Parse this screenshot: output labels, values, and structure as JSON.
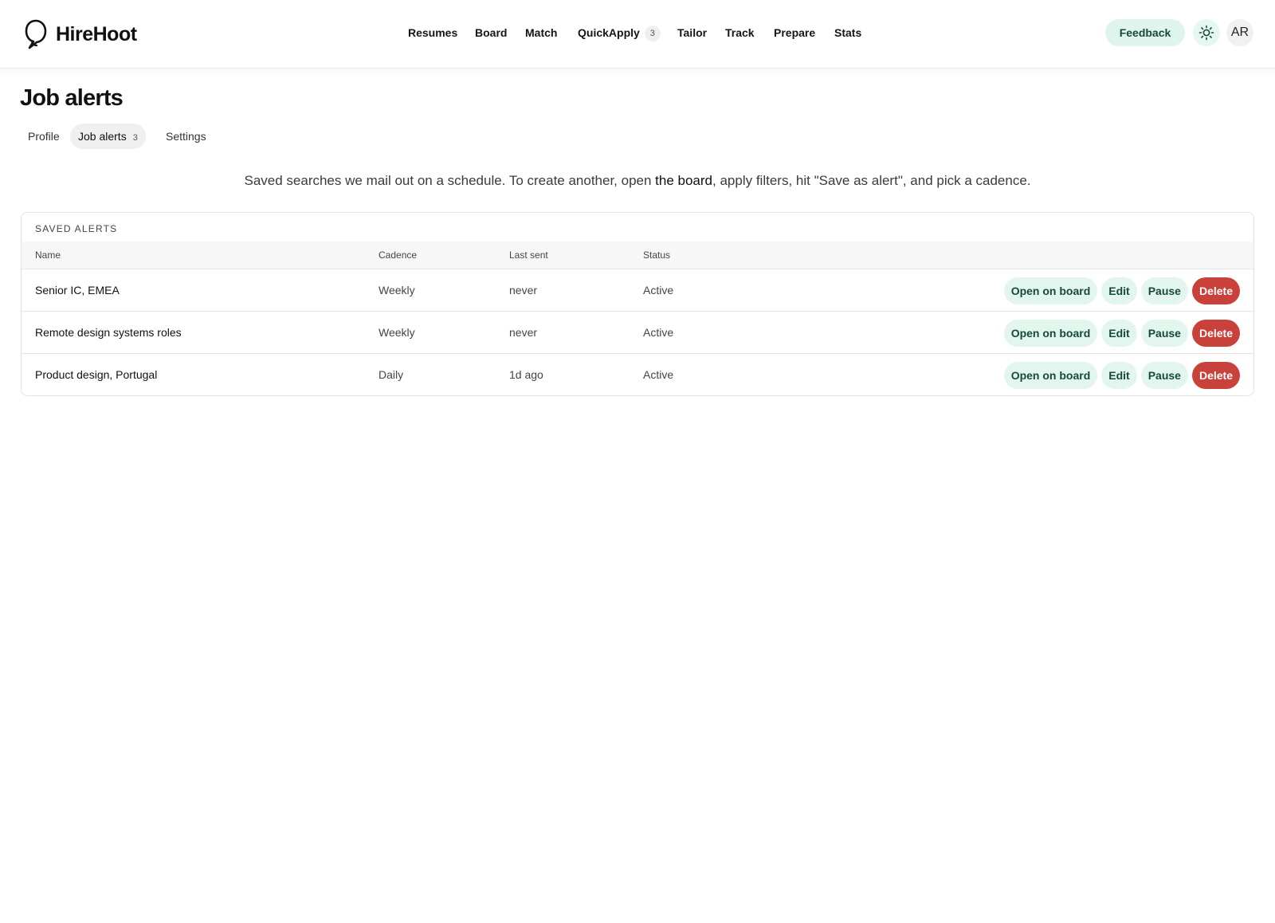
{
  "app": {
    "name": "HireHoot"
  },
  "nav": {
    "items": [
      {
        "label": "Resumes"
      },
      {
        "label": "Board"
      },
      {
        "label": "Match"
      },
      {
        "label": "QuickApply",
        "badge": "3"
      },
      {
        "label": "Tailor"
      },
      {
        "label": "Track"
      },
      {
        "label": "Prepare"
      },
      {
        "label": "Stats"
      }
    ]
  },
  "header": {
    "feedback_label": "Feedback",
    "theme_icon": "sun-icon",
    "avatar_initials": "AR"
  },
  "page": {
    "title": "Job alerts",
    "tabs": [
      {
        "label": "Profile"
      },
      {
        "label": "Job alerts",
        "count": "3"
      },
      {
        "label": "Settings"
      }
    ],
    "active_tab": "Job alerts",
    "intro_before": "Saved searches we mail out on a schedule. To create another, open ",
    "intro_link": "the board",
    "intro_after": ", apply filters, hit \"Save as alert\", and pick a cadence."
  },
  "alerts": {
    "section_label": "SAVED ALERTS",
    "columns": [
      "Name",
      "Cadence",
      "Last sent",
      "Status"
    ],
    "rows": [
      {
        "name": "Senior IC, EMEA",
        "cadence": "Weekly",
        "last_sent": "never",
        "status": "Active"
      },
      {
        "name": "Remote design systems roles",
        "cadence": "Weekly",
        "last_sent": "never",
        "status": "Active"
      },
      {
        "name": "Product design, Portugal",
        "cadence": "Daily",
        "last_sent": "1d ago",
        "status": "Active"
      }
    ],
    "actions": {
      "open": "Open on board",
      "edit": "Edit",
      "pause": "Pause",
      "delete": "Delete"
    }
  },
  "colors": {
    "accent_soft": "#e3f6ee",
    "accent_text": "#17493a",
    "danger": "#c8413a"
  }
}
